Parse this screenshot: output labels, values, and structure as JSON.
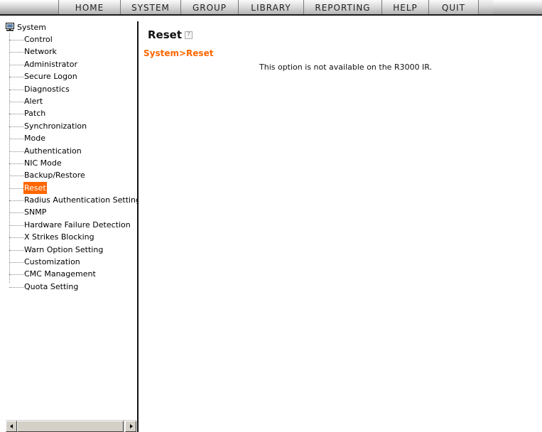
{
  "nav": {
    "items": [
      {
        "label": "HOME"
      },
      {
        "label": "SYSTEM"
      },
      {
        "label": "GROUP"
      },
      {
        "label": "LIBRARY"
      },
      {
        "label": "REPORTING"
      },
      {
        "label": "HELP"
      },
      {
        "label": "QUIT"
      }
    ]
  },
  "sidebar": {
    "root_label": "System",
    "root_icon": "computer-icon",
    "selected": "Reset",
    "items": [
      {
        "label": "Control"
      },
      {
        "label": "Network"
      },
      {
        "label": "Administrator"
      },
      {
        "label": "Secure Logon"
      },
      {
        "label": "Diagnostics"
      },
      {
        "label": "Alert"
      },
      {
        "label": "Patch"
      },
      {
        "label": "Synchronization"
      },
      {
        "label": "Mode"
      },
      {
        "label": "Authentication"
      },
      {
        "label": "NIC Mode"
      },
      {
        "label": "Backup/Restore"
      },
      {
        "label": "Reset"
      },
      {
        "label": "Radius Authentication Setting"
      },
      {
        "label": "SNMP"
      },
      {
        "label": "Hardware Failure Detection"
      },
      {
        "label": "X Strikes Blocking"
      },
      {
        "label": "Warn Option Setting"
      },
      {
        "label": "Customization"
      },
      {
        "label": "CMC Management"
      },
      {
        "label": "Quota Setting"
      }
    ]
  },
  "main": {
    "title": "Reset",
    "help_icon_glyph": "?",
    "breadcrumb": "System>Reset",
    "notice": "This option is not available on the R3000 IR."
  },
  "colors": {
    "accent": "#ff6600",
    "menu_border": "#1c1c1c"
  }
}
